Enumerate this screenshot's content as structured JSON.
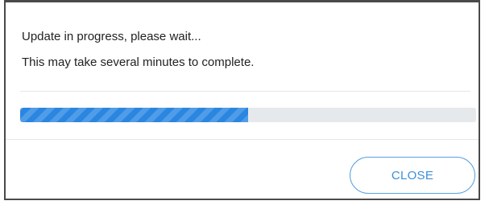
{
  "dialog": {
    "line1": "Update in progress, please wait...",
    "line2": "This may take several minutes to complete.",
    "progress_fraction": 0.5,
    "progress_color": "#2a86e0",
    "track_color": "#e6e9ec",
    "close_label": "CLOSE"
  }
}
